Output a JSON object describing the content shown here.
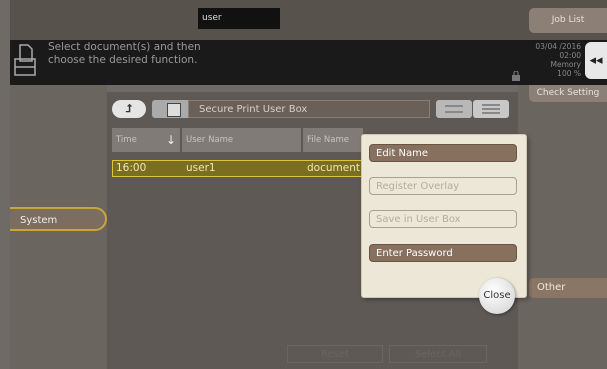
{
  "header": {
    "user": "user",
    "job_list": "Job List"
  },
  "message": {
    "line1": "Select document(s) and then",
    "line2": "choose the desired function."
  },
  "status": {
    "date": "03/04 /2016",
    "time": "02:00",
    "memory_label": "Memory",
    "memory_value": "100 %"
  },
  "back_label": "◂◂",
  "check_setting": "Check Setting",
  "left": {
    "system": "System"
  },
  "box": {
    "title": "Secure Print User Box",
    "up_glyph": "⮥"
  },
  "table": {
    "headers": {
      "time": "Time",
      "sort_glyph": "↓",
      "user": "User Name",
      "file": "File Name"
    },
    "rows": [
      {
        "time": "16:00",
        "user": "user1",
        "file": "document"
      }
    ]
  },
  "popup": {
    "items": [
      {
        "label": "Edit Name",
        "enabled": true
      },
      {
        "label": "Register Overlay",
        "enabled": false
      },
      {
        "label": "Save in User Box",
        "enabled": false
      },
      {
        "label": "Enter Password",
        "enabled": true
      }
    ],
    "close": "Close"
  },
  "right": {
    "other": "Other"
  },
  "footer": {
    "reset": "Reset",
    "select_all": "Select All"
  }
}
